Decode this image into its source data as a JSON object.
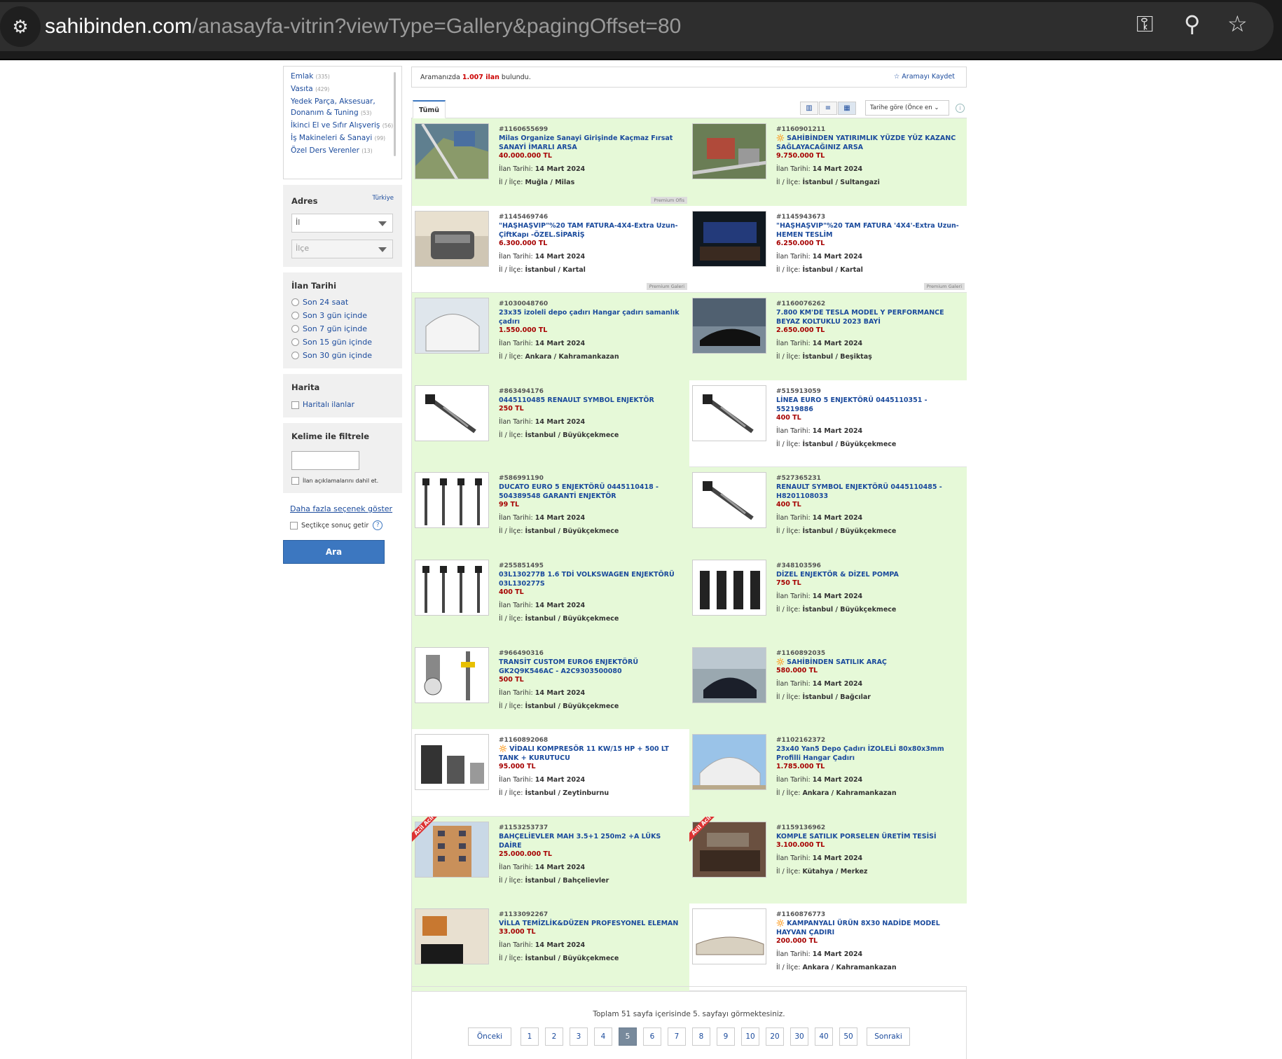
{
  "browser": {
    "url_host": "sahibinden.com",
    "url_path": "/anasayfa-vitrin?viewType=Gallery&pagingOffset=80",
    "icons": [
      "site-settings-icon",
      "key-icon",
      "zoom-icon",
      "star-icon"
    ]
  },
  "sidebar": {
    "categories": [
      {
        "name": "Emlak",
        "count": "(335)"
      },
      {
        "name": "Vasıta",
        "count": "(429)"
      },
      {
        "name": "Yedek Parça, Aksesuar, Donanım & Tuning",
        "count": "(53)"
      },
      {
        "name": "İkinci El ve Sıfır Alışveriş",
        "count": "(56)"
      },
      {
        "name": "İş Makineleri & Sanayi",
        "count": "(99)"
      },
      {
        "name": "Özel Ders Verenler",
        "count": "(13)"
      }
    ],
    "address": {
      "title": "Adres",
      "country": "Türkiye",
      "il": "İl",
      "ilce": "İlçe"
    },
    "date": {
      "title": "İlan Tarihi",
      "options": [
        "Son 24 saat",
        "Son 3 gün içinde",
        "Son 7 gün içinde",
        "Son 15 gün içinde",
        "Son 30 gün içinde"
      ]
    },
    "map": {
      "title": "Harita",
      "option": "Haritalı ilanlar"
    },
    "keyword": {
      "title": "Kelime ile filtrele",
      "include_desc": "İlan açıklamalarını dahil et."
    },
    "more_options": "Daha fazla seçenek göster",
    "instant": "Seçtikçe sonuç getir",
    "help": "?",
    "search_button": "Ara"
  },
  "results": {
    "prefix": "Aramanızda",
    "count": "1.007 ilan",
    "suffix": "bulundu.",
    "save": "☆ Aramayı Kaydet"
  },
  "tabs": {
    "all": "Tümü",
    "sort": "Tarihe göre (Önce en ⌄"
  },
  "labels": {
    "date": "İlan Tarihi:",
    "loc": "İl / İlçe:"
  },
  "listings": [
    {
      "id": "#1160655699",
      "title": "Milas Organize Sanayi Girişinde Kaçmaz Fırsat SANAYİ İMARLI ARSA",
      "price": "40.000.000 TL",
      "date": "14 Mart 2024",
      "loc": "Muğla / Milas",
      "bg": "g",
      "tag": "Premium Ofis",
      "img": "aerial",
      "ribbon": "",
      "emoji": ""
    },
    {
      "id": "#1160901211",
      "title": "SAHİBİNDEN YATIRIMLIK YÜZDE YÜZ KAZANC SAĞLAYACAĞINIZ ARSA",
      "price": "9.750.000 TL",
      "date": "14 Mart 2024",
      "loc": "İstanbul / Sultangazi",
      "bg": "g",
      "tag": "",
      "img": "town",
      "ribbon": "",
      "emoji": "🔆 "
    },
    {
      "id": "#1145469746",
      "title": "\"HAŞHAŞVIP\"%20 TAM FATURA-4X4-Extra Uzun-ÇiftKapı -ÖZEL.SİPARİŞ",
      "price": "6.300.000 TL",
      "date": "14 Mart 2024",
      "loc": "İstanbul / Kartal",
      "bg": "w",
      "tag": "Premium Galeri",
      "img": "van",
      "ribbon": "",
      "emoji": ""
    },
    {
      "id": "#1145943673",
      "title": "\"HAŞHAŞVIP\"%20 TAM FATURA '4X4'-Extra Uzun-HEMEN TESLİM",
      "price": "6.250.000 TL",
      "date": "14 Mart 2024",
      "loc": "İstanbul / Kartal",
      "bg": "w",
      "tag": "Premium Galeri",
      "img": "interior",
      "ribbon": "",
      "emoji": ""
    },
    {
      "id": "#1030048760",
      "title": "23x35 izoleli depo çadırı Hangar çadırı samanlık çadırı",
      "price": "1.550.000 TL",
      "date": "14 Mart 2024",
      "loc": "Ankara / Kahramankazan",
      "bg": "g",
      "tag": "",
      "img": "tent",
      "ribbon": "",
      "emoji": ""
    },
    {
      "id": "#1160076262",
      "title": "7.800 KM'DE TESLA MODEL Y PERFORMANCE BEYAZ KOLTUKLU 2023 BAYİ",
      "price": "2.650.000 TL",
      "date": "14 Mart 2024",
      "loc": "İstanbul / Beşiktaş",
      "bg": "g",
      "tag": "",
      "img": "tesla",
      "ribbon": "",
      "emoji": ""
    },
    {
      "id": "#863494176",
      "title": "0445110485 RENAULT SYMBOL ENJEKTÖR",
      "price": "250 TL",
      "date": "14 Mart 2024",
      "loc": "İstanbul / Büyükçekmece",
      "bg": "g",
      "tag": "",
      "img": "injector",
      "ribbon": "",
      "emoji": ""
    },
    {
      "id": "#515913059",
      "title": "LİNEA EURO 5 ENJEKTÖRÜ 0445110351 - 55219886",
      "price": "400 TL",
      "date": "14 Mart 2024",
      "loc": "İstanbul / Büyükçekmece",
      "bg": "w",
      "tag": "",
      "img": "injector",
      "ribbon": "",
      "emoji": ""
    },
    {
      "id": "#586991190",
      "title": "DUCATO EURO 5 ENJEKTÖRÜ 0445110418 - 504389548 GARANTİ ENJEKTÖR",
      "price": "99 TL",
      "date": "14 Mart 2024",
      "loc": "İstanbul / Büyükçekmece",
      "bg": "g",
      "tag": "",
      "img": "injectors",
      "ribbon": "",
      "emoji": ""
    },
    {
      "id": "#527365231",
      "title": "RENAULT SYMBOL ENJEKTÖRÜ 0445110485 - H8201108033",
      "price": "400 TL",
      "date": "14 Mart 2024",
      "loc": "İstanbul / Büyükçekmece",
      "bg": "g",
      "tag": "",
      "img": "injector",
      "ribbon": "",
      "emoji": ""
    },
    {
      "id": "#255851495",
      "title": "03L130277B 1.6 TDİ VOLKSWAGEN ENJEKTÖRÜ 03L130277S",
      "price": "400 TL",
      "date": "14 Mart 2024",
      "loc": "İstanbul / Büyükçekmece",
      "bg": "g",
      "tag": "",
      "img": "injectors",
      "ribbon": "",
      "emoji": ""
    },
    {
      "id": "#348103596",
      "title": "DİZEL ENJEKTÖR & DİZEL POMPA",
      "price": "750 TL",
      "date": "14 Mart 2024",
      "loc": "İstanbul / Büyükçekmece",
      "bg": "g",
      "tag": "",
      "img": "injectors2",
      "ribbon": "",
      "emoji": ""
    },
    {
      "id": "#966490316",
      "title": "TRANSİT CUSTOM EURO6 ENJEKTÖRÜ GK2Q9K546AC - A2C9303500080",
      "price": "500 TL",
      "date": "14 Mart 2024",
      "loc": "İstanbul / Büyükçekmece",
      "bg": "g",
      "tag": "",
      "img": "tester",
      "ribbon": "",
      "emoji": ""
    },
    {
      "id": "#1160892035",
      "title": "SAHİBİNDEN SATILIK ARAÇ",
      "price": "580.000 TL",
      "date": "14 Mart 2024",
      "loc": "İstanbul / Bağcılar",
      "bg": "g",
      "tag": "",
      "img": "car",
      "ribbon": "",
      "emoji": "🔆 "
    },
    {
      "id": "#1160892068",
      "title": "VİDALI KOMPRESÖR 11 KW/15 HP + 500 LT TANK + KURUTUCU",
      "price": "95.000 TL",
      "date": "14 Mart 2024",
      "loc": "İstanbul / Zeytinburnu",
      "bg": "w",
      "tag": "",
      "img": "compressor",
      "ribbon": "",
      "emoji": "🔆 "
    },
    {
      "id": "#1102162372",
      "title": "23x40 Yan5 Depo Çadırı İZOLELİ 80x80x3mm Profilli Hangar Çadırı",
      "price": "1.785.000 TL",
      "date": "14 Mart 2024",
      "loc": "Ankara / Kahramankazan",
      "bg": "g",
      "tag": "",
      "img": "tent2",
      "ribbon": "",
      "emoji": ""
    },
    {
      "id": "#1153253737",
      "title": "BAHÇELİEVLER MAH 3.5+1 250m2 +A LÜKS DAİRE",
      "price": "25.000.000 TL",
      "date": "14 Mart 2024",
      "loc": "İstanbul / Bahçelievler",
      "bg": "g",
      "tag": "",
      "img": "building",
      "ribbon": "Acil Acil",
      "emoji": ""
    },
    {
      "id": "#1159136962",
      "title": "KOMPLE SATILIK PORSELEN ÜRETİM TESİSİ",
      "price": "3.100.000 TL",
      "date": "14 Mart 2024",
      "loc": "Kütahya / Merkez",
      "bg": "g",
      "tag": "",
      "img": "factory",
      "ribbon": "Acil Acil",
      "emoji": ""
    },
    {
      "id": "#1133092267",
      "title": "VİLLA TEMİZLİK&DÜZEN PROFESYONEL ELEMAN",
      "price": "33.000 TL",
      "date": "14 Mart 2024",
      "loc": "İstanbul / Büyükçekmece",
      "bg": "g",
      "tag": "",
      "img": "villa",
      "ribbon": "",
      "emoji": ""
    },
    {
      "id": "#1160876773",
      "title": "KAMPANYALI ÜRÜN 8X30 NADİDE MODEL HAYVAN ÇADIRI",
      "price": "200.000 TL",
      "date": "14 Mart 2024",
      "loc": "Ankara / Kahramankazan",
      "bg": "w",
      "tag": "",
      "img": "barn",
      "ribbon": "",
      "emoji": "🔆 "
    }
  ],
  "pager": {
    "summary": "Toplam 51 sayfa içerisinde 5. sayfayı görmektesiniz.",
    "prev": "Önceki",
    "next": "Sonraki",
    "pages": [
      "1",
      "2",
      "3",
      "4",
      "5",
      "6",
      "7",
      "8",
      "9",
      "10",
      "20",
      "30",
      "40",
      "50"
    ],
    "current": "5"
  }
}
